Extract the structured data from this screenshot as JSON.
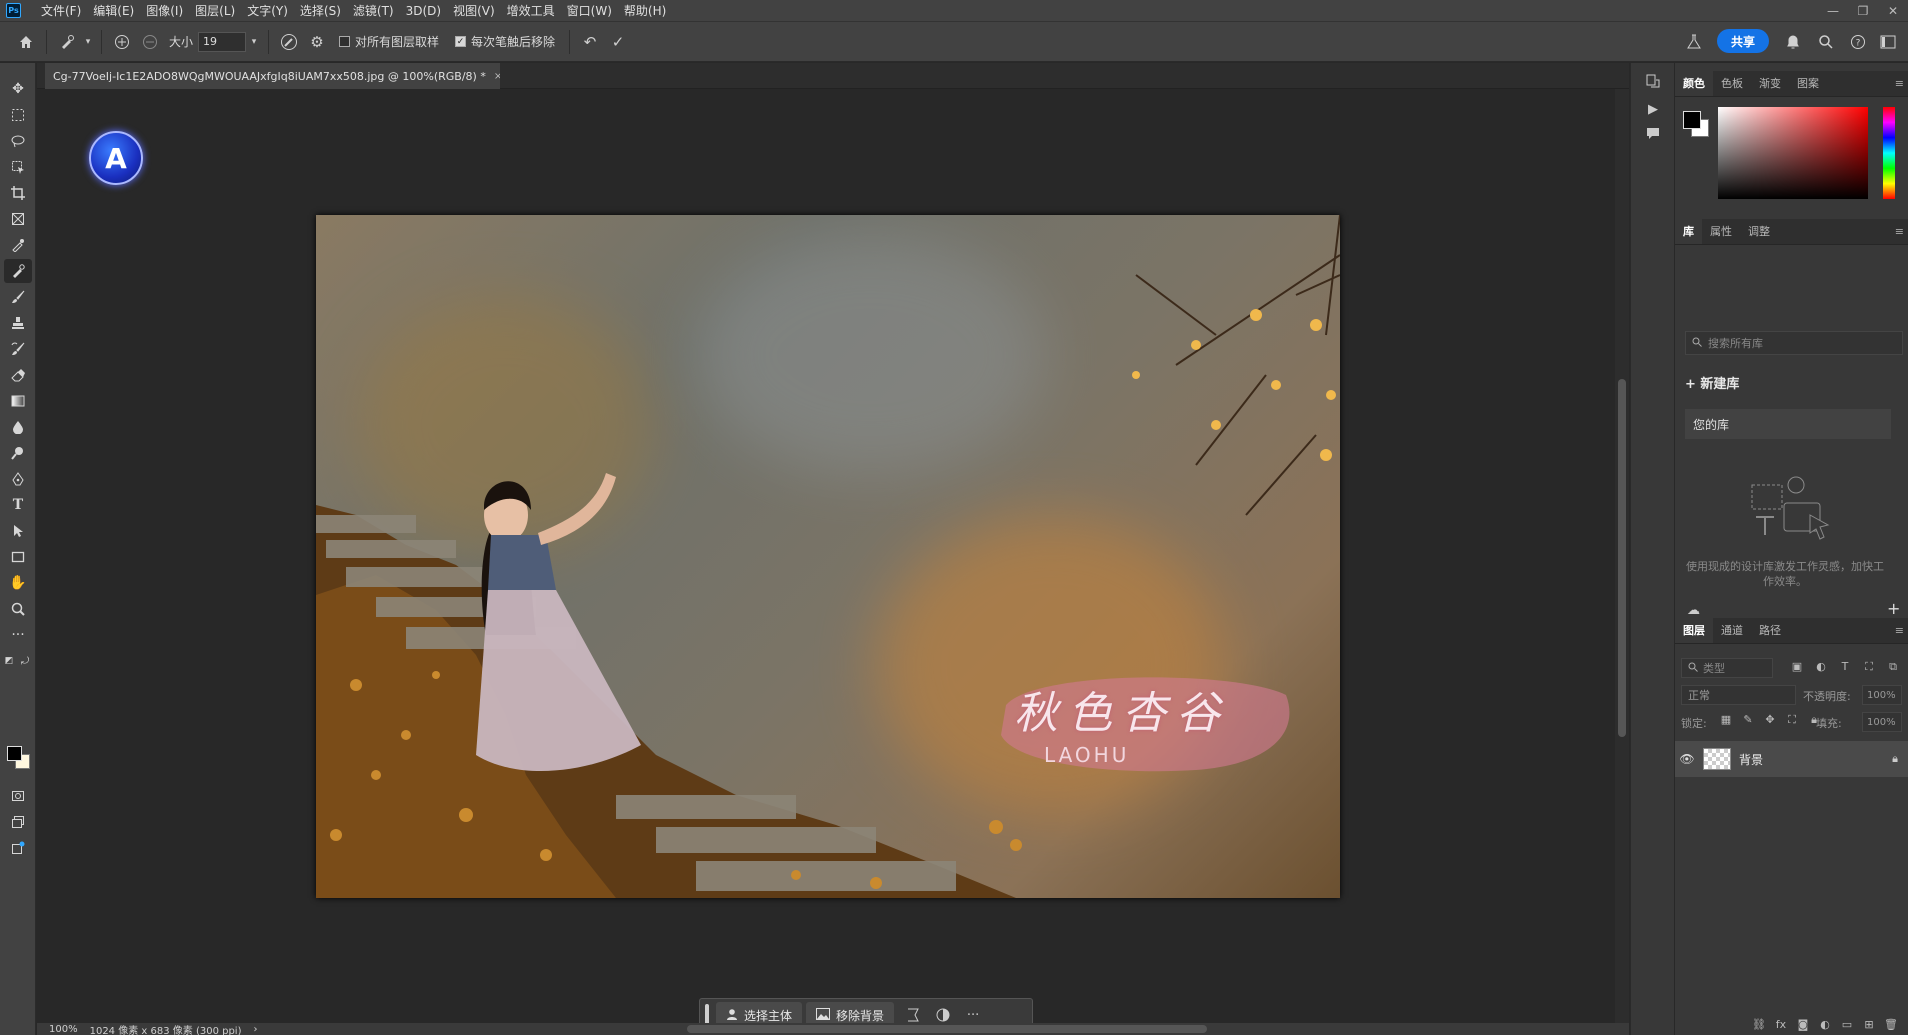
{
  "app": {
    "logo": "Ps"
  },
  "menu": [
    "文件(F)",
    "编辑(E)",
    "图像(I)",
    "图层(L)",
    "文字(Y)",
    "选择(S)",
    "滤镜(T)",
    "3D(D)",
    "视图(V)",
    "增效工具",
    "窗口(W)",
    "帮助(H)"
  ],
  "window": {
    "minimize": "—",
    "restore": "❐",
    "close": "✕"
  },
  "options": {
    "size_label": "大小",
    "size_value": "19",
    "sample_all_layers": "对所有图层取样",
    "sample_all_checked": false,
    "remove_after_stroke": "每次笔触后移除",
    "remove_after_checked": true,
    "share": "共享"
  },
  "document": {
    "tab_title": "Cg-77VoeIj-Ic1E2ADO8WQgMWOUAAJxfgIq8iUAM7xx508.jpg @ 100%(RGB/8) *",
    "close": "×"
  },
  "badge_letter": "A",
  "watermark": {
    "title": "秋色杏谷",
    "subtitle": "LAOHU"
  },
  "context_bar": {
    "select_subject": "选择主体",
    "remove_background": "移除背景",
    "more": "···"
  },
  "status": {
    "zoom": "100%",
    "dimensions": "1024 像素 x 683 像素 (300 ppi)",
    "arrow": "›"
  },
  "color_panel": {
    "tabs": [
      "颜色",
      "色板",
      "渐变",
      "图案"
    ],
    "active": 0
  },
  "library_panel": {
    "tabs": [
      "库",
      "属性",
      "调整"
    ],
    "active": 0,
    "search_placeholder": "搜索所有库",
    "new_library": "+ 新建库",
    "your_libraries": "您的库",
    "description": "使用现成的设计库激发工作灵感，加快工作效率。"
  },
  "layers_panel": {
    "tabs": [
      "图层",
      "通道",
      "路径"
    ],
    "active": 0,
    "filter_placeholder": "类型",
    "blend_mode": "正常",
    "opacity_label": "不透明度:",
    "opacity_value": "100%",
    "lock_label": "锁定:",
    "fill_label": "填充:",
    "fill_value": "100%",
    "layers": [
      {
        "name": "背景",
        "visible": true,
        "locked": true
      }
    ]
  },
  "colors": {
    "accent": "#1473e6",
    "foreground": "#000000",
    "background": "#ffffff"
  }
}
